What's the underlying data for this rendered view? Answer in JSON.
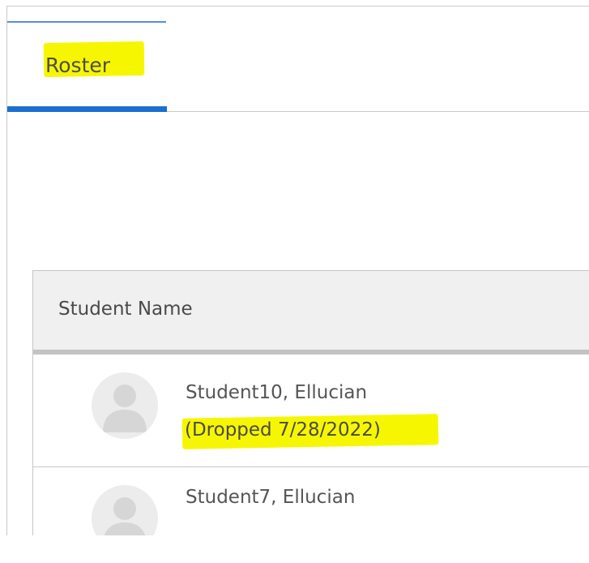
{
  "tabs": {
    "roster_label": "Roster"
  },
  "roster": {
    "column_header": "Student Name",
    "students": [
      {
        "name": "Student10, Ellucian",
        "status": "(Dropped 7/28/2022)",
        "avatar_icon": "person-silhouette-icon"
      },
      {
        "name": "Student7, Ellucian",
        "avatar_icon": "person-silhouette-icon"
      }
    ]
  },
  "colors": {
    "tab_active_underline": "#1a6fd1",
    "highlighter": "#f6f600",
    "header_background": "#f0f0f0",
    "text": "#4d4d4d"
  }
}
